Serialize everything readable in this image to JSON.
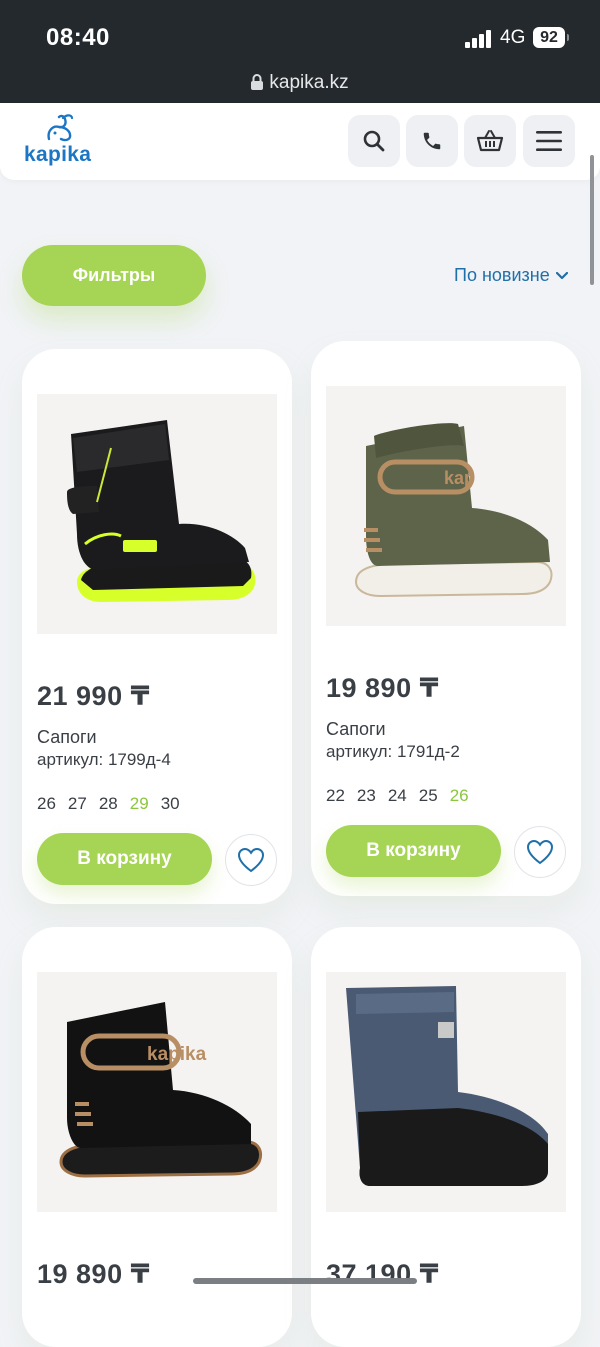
{
  "status_bar": {
    "time": "08:40",
    "network": "4G",
    "battery": "92",
    "url": "kapika.kz"
  },
  "header": {
    "logo_text": "kapika",
    "icons": [
      "search-icon",
      "phone-icon",
      "basket-icon",
      "menu-icon"
    ]
  },
  "toolbar": {
    "filters_label": "Фильтры",
    "sort_label": "По новизне"
  },
  "colors": {
    "accent_green": "#a6d454",
    "active_size": "#8cc63f",
    "link_blue": "#1f6fa9"
  },
  "products": [
    {
      "price": "21 990 ₸",
      "name": "Сапоги",
      "sku": "артикул: 1799д-4",
      "sizes": [
        "26",
        "27",
        "28",
        "29",
        "30"
      ],
      "active_size": "29",
      "cart_label": "В корзину"
    },
    {
      "price": "19 890 ₸",
      "name": "Сапоги",
      "sku": "артикул: 1791д-2",
      "sizes": [
        "22",
        "23",
        "24",
        "25",
        "26"
      ],
      "active_size": "26",
      "cart_label": "В корзину"
    },
    {
      "price": "19 890 ₸"
    },
    {
      "price": "37 190 ₸"
    }
  ]
}
